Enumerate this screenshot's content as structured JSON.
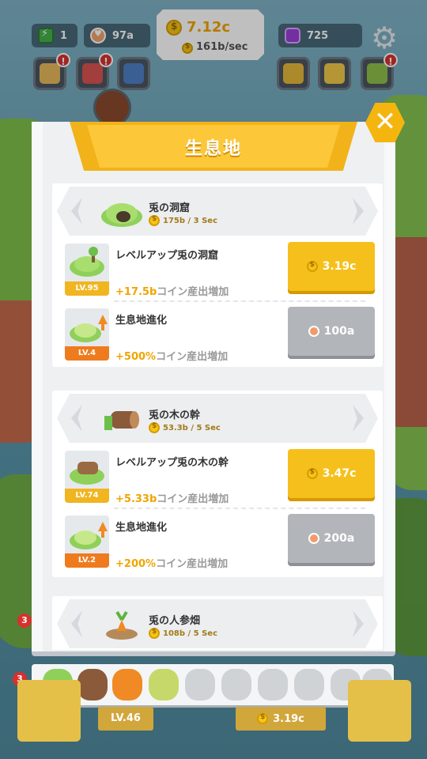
{
  "hud": {
    "energy": "1",
    "hearts": "97a",
    "coins": "7.12c",
    "coin_rate": "161b/sec",
    "gems": "725"
  },
  "modal": {
    "title": "生息地",
    "close_label": "✕"
  },
  "habitats": [
    {
      "name": "兎の洞窟",
      "rate": "175b / 3 Sec",
      "level_up": {
        "title": "レベルアップ兎の洞窟",
        "level": "LV.95",
        "bonus": "+17.5b",
        "desc": "コイン産出増加",
        "cost": "3.19c"
      },
      "evolve": {
        "title": "生息地進化",
        "level": "LV.4",
        "bonus": "+500%",
        "desc": "コイン産出増加",
        "cost": "100a"
      }
    },
    {
      "name": "兎の木の幹",
      "rate": "53.3b / 5 Sec",
      "level_up": {
        "title": "レベルアップ兎の木の幹",
        "level": "LV.74",
        "bonus": "+5.33b",
        "desc": "コイン産出増加",
        "cost": "3.47c"
      },
      "evolve": {
        "title": "生息地進化",
        "level": "LV.2",
        "bonus": "+200%",
        "desc": "コイン産出増加",
        "cost": "200a"
      }
    },
    {
      "name": "兎の人参畑",
      "rate": "108b / 5 Sec"
    }
  ],
  "bottom": {
    "level": "LV.46",
    "cost": "3.19c",
    "badge_left_top": "3",
    "badge_left_bottom": "3"
  },
  "icons": {
    "alert": "!"
  }
}
